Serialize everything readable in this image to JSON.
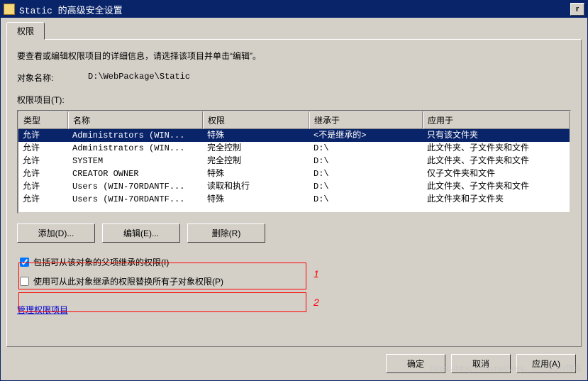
{
  "window": {
    "title": "Static 的高级安全设置",
    "close_glyph": "r"
  },
  "tab": {
    "permissions": "权限"
  },
  "instruction": "要查看或编辑权限项目的详细信息，请选择该项目并单击“编辑”。",
  "object": {
    "label": "对象名称:",
    "value": "D:\\WebPackage\\Static"
  },
  "perm_items_label": "权限项目(T):",
  "columns": {
    "type": "类型",
    "name": "名称",
    "perm": "权限",
    "inherited": "继承于",
    "apply": "应用于"
  },
  "rows": [
    {
      "type": "允许",
      "name": "Administrators (WIN...",
      "perm": "特殊",
      "inherited": "<不是继承的>",
      "apply": "只有该文件夹",
      "selected": true
    },
    {
      "type": "允许",
      "name": "Administrators (WIN...",
      "perm": "完全控制",
      "inherited": "D:\\",
      "apply": "此文件夹、子文件夹和文件",
      "selected": false
    },
    {
      "type": "允许",
      "name": "SYSTEM",
      "perm": "完全控制",
      "inherited": "D:\\",
      "apply": "此文件夹、子文件夹和文件",
      "selected": false
    },
    {
      "type": "允许",
      "name": "CREATOR OWNER",
      "perm": "特殊",
      "inherited": "D:\\",
      "apply": "仅子文件夹和文件",
      "selected": false
    },
    {
      "type": "允许",
      "name": "Users (WIN-7ORDANTF...",
      "perm": "读取和执行",
      "inherited": "D:\\",
      "apply": "此文件夹、子文件夹和文件",
      "selected": false
    },
    {
      "type": "允许",
      "name": "Users (WIN-7ORDANTF...",
      "perm": "特殊",
      "inherited": "D:\\",
      "apply": "此文件夹和子文件夹",
      "selected": false
    }
  ],
  "buttons": {
    "add": "添加(D)...",
    "edit": "编辑(E)...",
    "remove": "删除(R)"
  },
  "checkboxes": {
    "include_inherit": {
      "label": "包括可从该对象的父项继承的权限(I)",
      "checked": true
    },
    "replace_child": {
      "label": "使用可从此对象继承的权限替换所有子对象权限(P)",
      "checked": false
    }
  },
  "annotations": {
    "n1": "1",
    "n2": "2"
  },
  "link": "管理权限项目",
  "footer": {
    "ok": "确定",
    "cancel": "取消",
    "apply": "应用(A)"
  },
  "watermark": "https://blog.csdn.net/wey... 的CSDN博客"
}
